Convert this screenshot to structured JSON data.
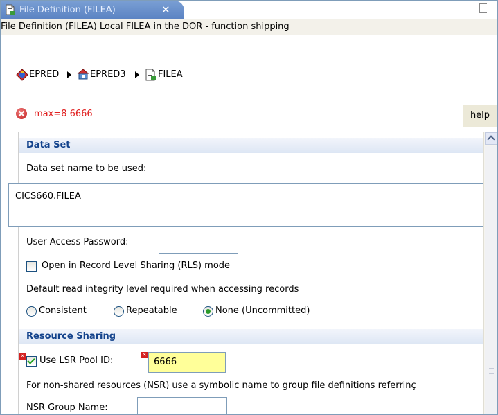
{
  "tab": {
    "title": "File Definition (FILEA)",
    "close": "✕"
  },
  "description": "File Definition (FILEA) Local FILEA in the DOR - function shipping",
  "breadcrumb": [
    {
      "label": "EPRED",
      "icon": "region-group-icon"
    },
    {
      "label": "EPRED3",
      "icon": "region-icon"
    },
    {
      "label": "FILEA",
      "icon": "file-definition-icon"
    }
  ],
  "error": {
    "message": "max=8 6666",
    "help_label": "help"
  },
  "data_set": {
    "heading": "Data Set",
    "name_label": "Data set name to be used:",
    "name_value": "CICS660.FILEA",
    "password_label": "User Access Password:",
    "password_value": "",
    "rls_label": "Open in Record Level Sharing (RLS) mode",
    "rls_checked": false,
    "integrity_label": "Default read integrity level required when accessing records",
    "integrity_options": [
      "Consistent",
      "Repeatable",
      "None (Uncommitted)"
    ],
    "integrity_selected": "None (Uncommitted)"
  },
  "resource_sharing": {
    "heading": "Resource Sharing",
    "lsr_label": "Use LSR Pool ID:",
    "lsr_checked": true,
    "lsr_value": "6666",
    "nsr_note": "For non-shared resources (NSR) use a symbolic name to group file definitions referrinç",
    "nsr_label": "NSR Group Name:",
    "nsr_value": ""
  },
  "colors": {
    "error": "#e02020",
    "section_text": "#14438c",
    "tab_bg": "#6a90cb",
    "invalid_field": "#ffff99"
  }
}
